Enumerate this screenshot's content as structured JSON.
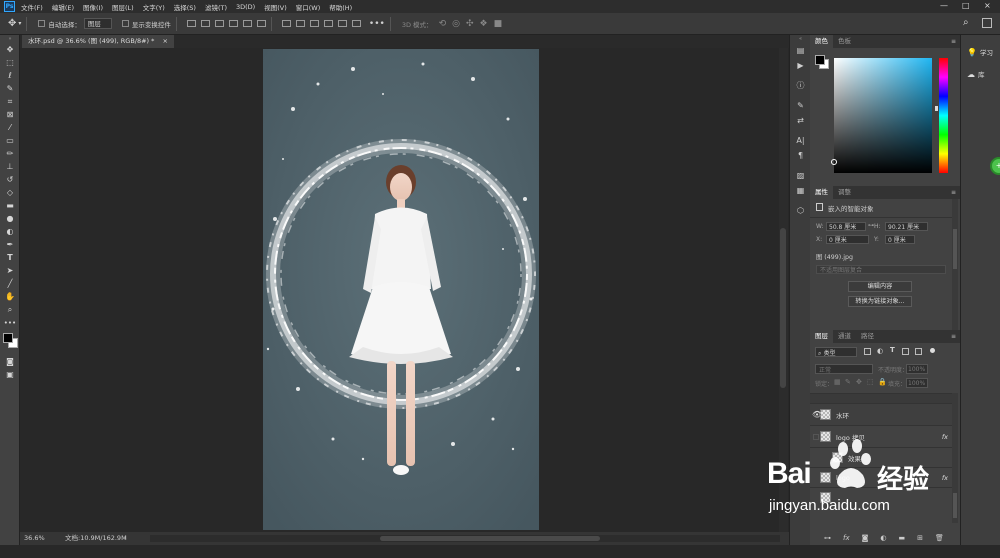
{
  "menubar": {
    "logo": "Ps",
    "items": [
      "文件(F)",
      "编辑(E)",
      "图像(I)",
      "图层(L)",
      "文字(Y)",
      "选择(S)",
      "滤镜(T)",
      "3D(D)",
      "视图(V)",
      "窗口(W)",
      "帮助(H)"
    ],
    "window_controls": [
      "—",
      "□",
      "×"
    ]
  },
  "options": {
    "auto_select_label": "自动选择：",
    "auto_select_value": "图层",
    "show_transform_label": "显示变换控件",
    "mode_3d_label": "3D 模式："
  },
  "document": {
    "tab_title": "水环.psd @ 36.6% (图 (499), RGB/8#) *",
    "tab_close": "×"
  },
  "status": {
    "zoom": "36.6%",
    "doc_size": "文档:10.9M/162.9M"
  },
  "panels": {
    "color_tabs": [
      "颜色",
      "色板"
    ],
    "properties_tabs": [
      "属性",
      "调整"
    ],
    "properties": {
      "type_label": "嵌入的智能对象",
      "w_label": "W:",
      "w_value": "50.8 厘米",
      "h_label": "H:",
      "h_value": "90.21 厘米",
      "x_label": "X:",
      "x_value": "0 厘米",
      "y_label": "Y:",
      "y_value": "0 厘米",
      "filename": "图 (499).jpg",
      "comp_placeholder": "不适用图层复合",
      "edit_contents": "编辑内容",
      "convert_linked": "转换为链接对象..."
    },
    "layers_tabs": [
      "图层",
      "通道",
      "路径"
    ],
    "layers": {
      "filter_kind": "类型",
      "blend_mode": "正常",
      "opacity_label": "不透明度：",
      "opacity_value": "100%",
      "lock_label": "锁定：",
      "fill_label": "填充：",
      "fill_value": "100%",
      "rows": [
        {
          "name": "水环",
          "fx": ""
        },
        {
          "name": "logo 拷贝",
          "fx": "fx"
        },
        {
          "name": "效果",
          "fx": ""
        },
        {
          "name": "logo",
          "fx": "fx"
        },
        {
          "name": "",
          "fx": ""
        }
      ]
    }
  },
  "learn": {
    "learn_label": "学习",
    "library_label": "库"
  },
  "watermark": {
    "brand_prefix": "Bai",
    "brand_suffix": "经验",
    "url": "jingyan.baidu.com"
  },
  "colors": {
    "canvas_bg": "#4e6068",
    "foreground": "#000000",
    "background": "#ffffff",
    "accent": "#31a8ff"
  }
}
